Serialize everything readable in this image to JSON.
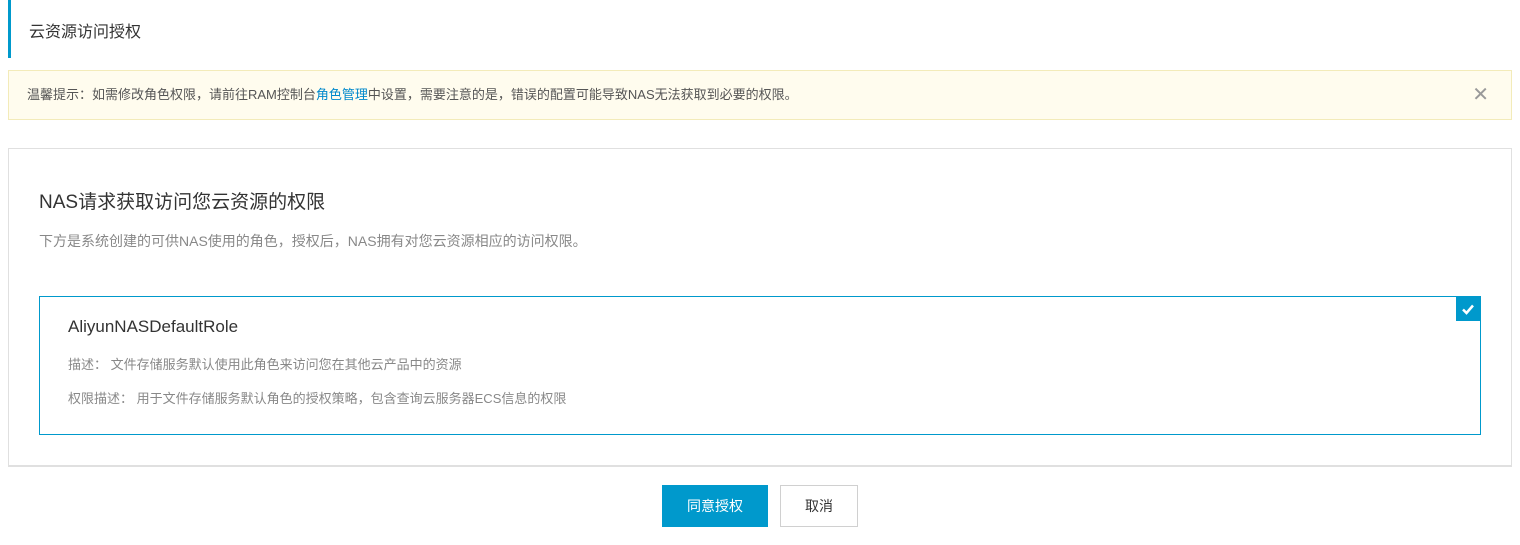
{
  "header": {
    "title": "云资源访问授权"
  },
  "notice": {
    "prefix": "温馨提示：如需修改角色权限，请前往RAM控制台",
    "link_text": "角色管理",
    "suffix": "中设置，需要注意的是，错误的配置可能导致NAS无法获取到必要的权限。"
  },
  "main": {
    "heading": "NAS请求获取访问您云资源的权限",
    "subtext": "下方是系统创建的可供NAS使用的角色，授权后，NAS拥有对您云资源相应的访问权限。"
  },
  "role": {
    "name": "AliyunNASDefaultRole",
    "desc_label": "描述：",
    "desc_value": "文件存储服务默认使用此角色来访问您在其他云产品中的资源",
    "perm_label": "权限描述：",
    "perm_value": "用于文件存储服务默认角色的授权策略，包含查询云服务器ECS信息的权限"
  },
  "footer": {
    "confirm": "同意授权",
    "cancel": "取消"
  }
}
